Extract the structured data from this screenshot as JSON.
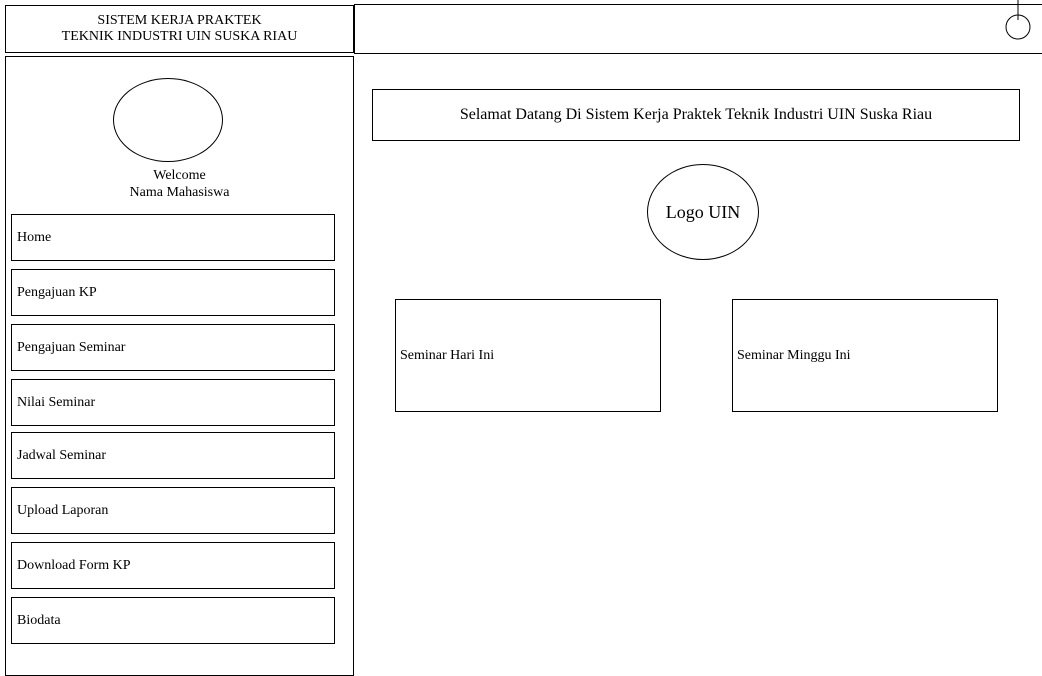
{
  "header": {
    "title_line1": "SISTEM KERJA PRAKTEK",
    "title_line2": "TEKNIK INDUSTRI UIN SUSKA RIAU",
    "power_icon": "power-icon"
  },
  "sidebar": {
    "avatar_icon": "avatar-circle",
    "welcome_line1": "Welcome",
    "welcome_line2": "Nama Mahasiswa",
    "items": [
      {
        "label": "Home"
      },
      {
        "label": "Pengajuan KP"
      },
      {
        "label": "Pengajuan Seminar"
      },
      {
        "label": "Nilai Seminar"
      },
      {
        "label": "Jadwal Seminar"
      },
      {
        "label": "Upload Laporan"
      },
      {
        "label": "Download Form KP"
      },
      {
        "label": "Biodata"
      }
    ]
  },
  "main": {
    "welcome_banner": "Selamat Datang Di Sistem Kerja Praktek Teknik Industri UIN Suska Riau",
    "logo_label": "Logo UIN",
    "cards": [
      {
        "label": "Seminar Hari Ini"
      },
      {
        "label": "Seminar Minggu Ini"
      }
    ]
  }
}
